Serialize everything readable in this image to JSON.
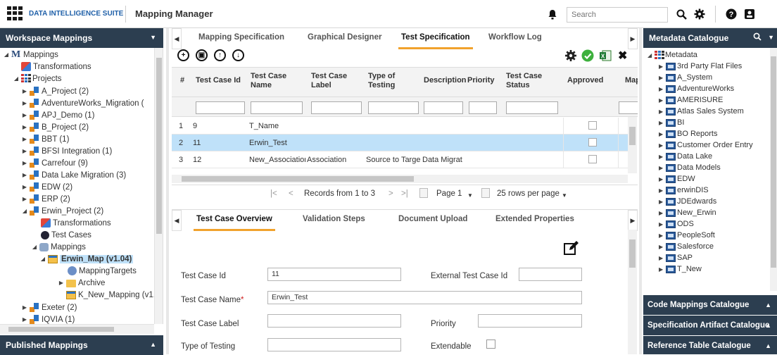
{
  "topbar": {
    "suite_name": "DATA INTELLIGENCE SUITE",
    "app_name": "Mapping Manager",
    "search_placeholder": "Search"
  },
  "left_panel": {
    "title": "Workspace Mappings",
    "footer_title": "Published Mappings",
    "tree": [
      {
        "label": "Mappings",
        "icon": "mappings-icon"
      },
      {
        "label": "Transformations",
        "icon": "transformations-icon"
      },
      {
        "label": "Projects",
        "icon": "projects-icon"
      },
      {
        "label": "A_Project (2)",
        "icon": "project-icon"
      },
      {
        "label": "AdventureWorks_Migration (",
        "icon": "project-icon"
      },
      {
        "label": "APJ_Demo (1)",
        "icon": "project-icon"
      },
      {
        "label": "B_Project (2)",
        "icon": "project-icon"
      },
      {
        "label": "BBT (1)",
        "icon": "project-icon"
      },
      {
        "label": "BFSI Integration (1)",
        "icon": "project-icon"
      },
      {
        "label": "Carrefour (9)",
        "icon": "project-icon"
      },
      {
        "label": "Data Lake Migration (3)",
        "icon": "project-icon"
      },
      {
        "label": "EDW (2)",
        "icon": "project-icon"
      },
      {
        "label": "ERP (2)",
        "icon": "project-icon"
      },
      {
        "label": "Erwin_Project (2)",
        "icon": "project-icon"
      },
      {
        "label": "Transformations",
        "icon": "transformations-icon"
      },
      {
        "label": "Test Cases",
        "icon": "test-cases-icon"
      },
      {
        "label": "Mappings",
        "icon": "mappings-folder-icon"
      },
      {
        "label": "Erwin_Map (v1.04)",
        "icon": "mapping-icon"
      },
      {
        "label": "MappingTargets",
        "icon": "mapping-targets-icon"
      },
      {
        "label": "Archive",
        "icon": "archive-folder-icon"
      },
      {
        "label": "K_New_Mapping (v1.",
        "icon": "mapping-icon"
      },
      {
        "label": "Exeter (2)",
        "icon": "project-icon"
      },
      {
        "label": "IQVIA (1)",
        "icon": "project-icon"
      }
    ]
  },
  "center": {
    "tabs": [
      "Mapping Specification",
      "Graphical Designer",
      "Test Specification",
      "Workflow Log"
    ],
    "active_tab": "Test Specification",
    "grid": {
      "columns": [
        "#",
        "Test Case Id",
        "Test Case Name",
        "Test Case Label",
        "Type of Testing",
        "Description",
        "Priority",
        "Test Case Status",
        "Approved",
        "Map"
      ],
      "rows": [
        {
          "num": "1",
          "id": "9",
          "name": "T_Name",
          "label": "",
          "type": "",
          "description": "",
          "selected": false
        },
        {
          "num": "2",
          "id": "11",
          "name": "Erwin_Test",
          "label": "",
          "type": "",
          "description": "",
          "selected": true
        },
        {
          "num": "3",
          "id": "12",
          "name": "New_Associatior",
          "label": "Association",
          "type": "Source to Targe",
          "description": "Data Migrat",
          "selected": false
        }
      ]
    },
    "pager": {
      "records": "Records from 1 to 3",
      "page": "Page 1",
      "rows_per_page": "25 rows per page"
    },
    "detail_tabs": [
      "Test Case Overview",
      "Validation Steps",
      "Document Upload",
      "Extended Properties"
    ],
    "active_detail_tab": "Test Case Overview",
    "form": {
      "test_case_id_label": "Test Case Id",
      "test_case_id": "11",
      "external_id_label": "External Test Case Id",
      "external_id": "",
      "test_case_name_label": "Test Case Name",
      "required_mark": "*",
      "test_case_name": "Erwin_Test",
      "test_case_label_label": "Test Case Label",
      "test_case_label": "",
      "priority_label": "Priority",
      "priority": "",
      "type_of_testing_label": "Type of Testing",
      "type_of_testing": "",
      "extendable_label": "Extendable"
    }
  },
  "right_panel": {
    "title": "Metadata Catalogue",
    "tree_root": "Metadata",
    "items": [
      "3rd Party Flat Files",
      "A_System",
      "AdventureWorks",
      "AMERISURE",
      "Atlas Sales System",
      "BI",
      "BO Reports",
      "Customer Order Entry",
      "Data Lake",
      "Data Models",
      "EDW",
      "erwinDIS",
      "JDEdwards",
      "New_Erwin",
      "ODS",
      "PeopleSoft",
      "Salesforce",
      "SAP",
      "T_New"
    ],
    "sections": [
      "Code Mappings Catalogue",
      "Specification Artifact Catalogue",
      "Reference Table Catalogue"
    ]
  },
  "colors": {
    "panel_header": "#2c3e50",
    "active_tab_underline": "#f1a22c",
    "selected_row": "#bfe1f9",
    "brand_blue": "#1e5fa8"
  }
}
